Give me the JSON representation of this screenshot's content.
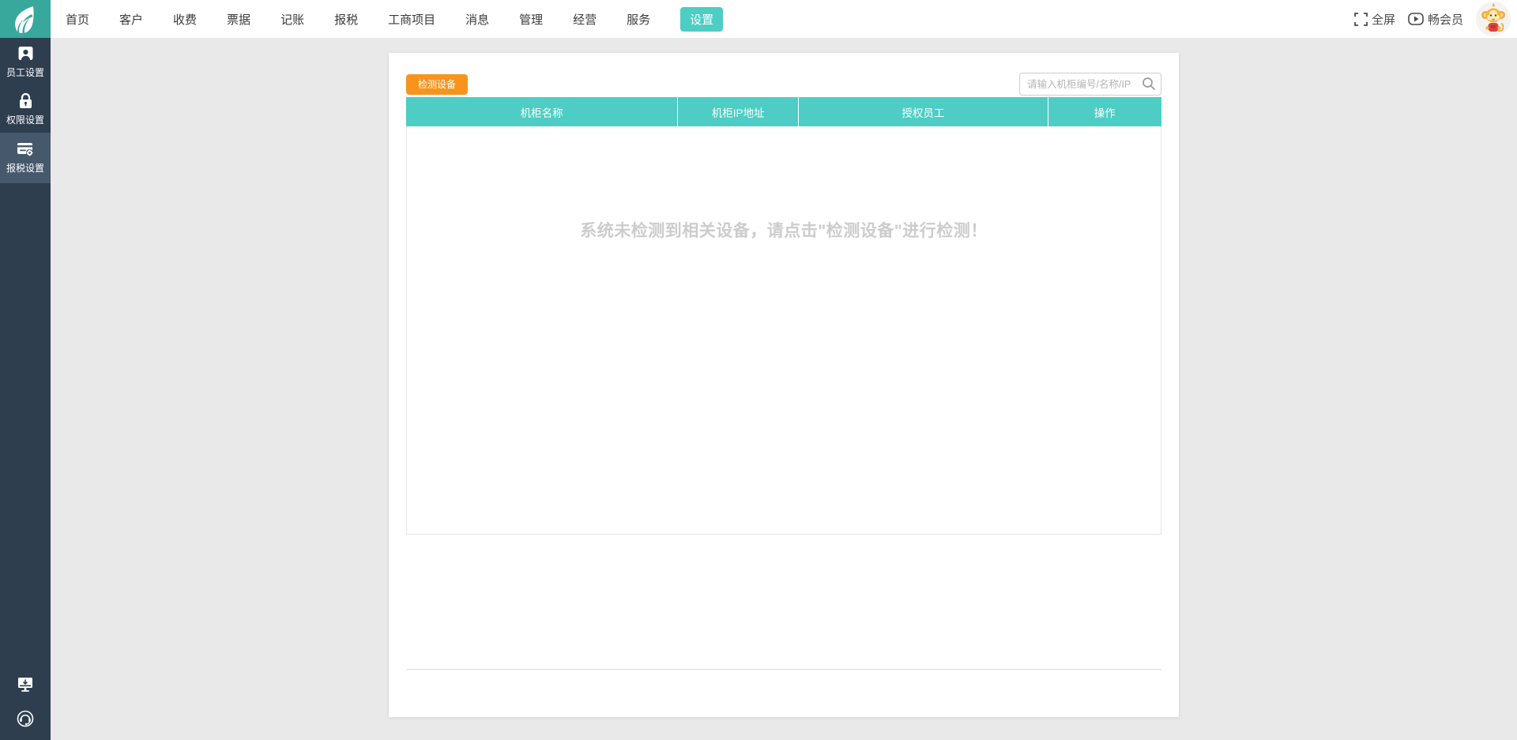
{
  "topbar": {
    "nav_items": [
      {
        "label": "首页"
      },
      {
        "label": "客户"
      },
      {
        "label": "收费"
      },
      {
        "label": "票据"
      },
      {
        "label": "记账"
      },
      {
        "label": "报税"
      },
      {
        "label": "工商项目"
      },
      {
        "label": "消息"
      },
      {
        "label": "管理"
      },
      {
        "label": "经营"
      },
      {
        "label": "服务"
      },
      {
        "label": "设置"
      }
    ],
    "active_nav": "设置",
    "fullscreen_label": "全屏",
    "member_label": "畅会员"
  },
  "sidebar": {
    "items": [
      {
        "label": "员工设置",
        "icon": "employee-badge-icon",
        "active": false
      },
      {
        "label": "权限设置",
        "icon": "lock-icon",
        "active": false
      },
      {
        "label": "报税设置",
        "icon": "tax-card-gear-icon",
        "active": true
      }
    ],
    "bottom_icons": [
      "client-download-icon",
      "customer-service-icon"
    ]
  },
  "content": {
    "detect_button_label": "检测设备",
    "search_placeholder": "请输入机柜编号/名称/IP",
    "search_value": "",
    "table_headers": [
      "机柜名称",
      "机柜IP地址",
      "授权员工",
      "操作"
    ],
    "empty_message": "系统未检测到相关设备，请点击\"检测设备\"进行检测！"
  },
  "colors": {
    "brand_teal": "#38a89d",
    "accent_teal": "#4dcdc4",
    "sidebar_bg": "#2e3e4f",
    "sidebar_active_bg": "#46586c",
    "button_orange": "#f7941e",
    "page_bg": "#e9e9e9",
    "empty_text": "#cccccc",
    "table_border": "#e6e6e6"
  }
}
